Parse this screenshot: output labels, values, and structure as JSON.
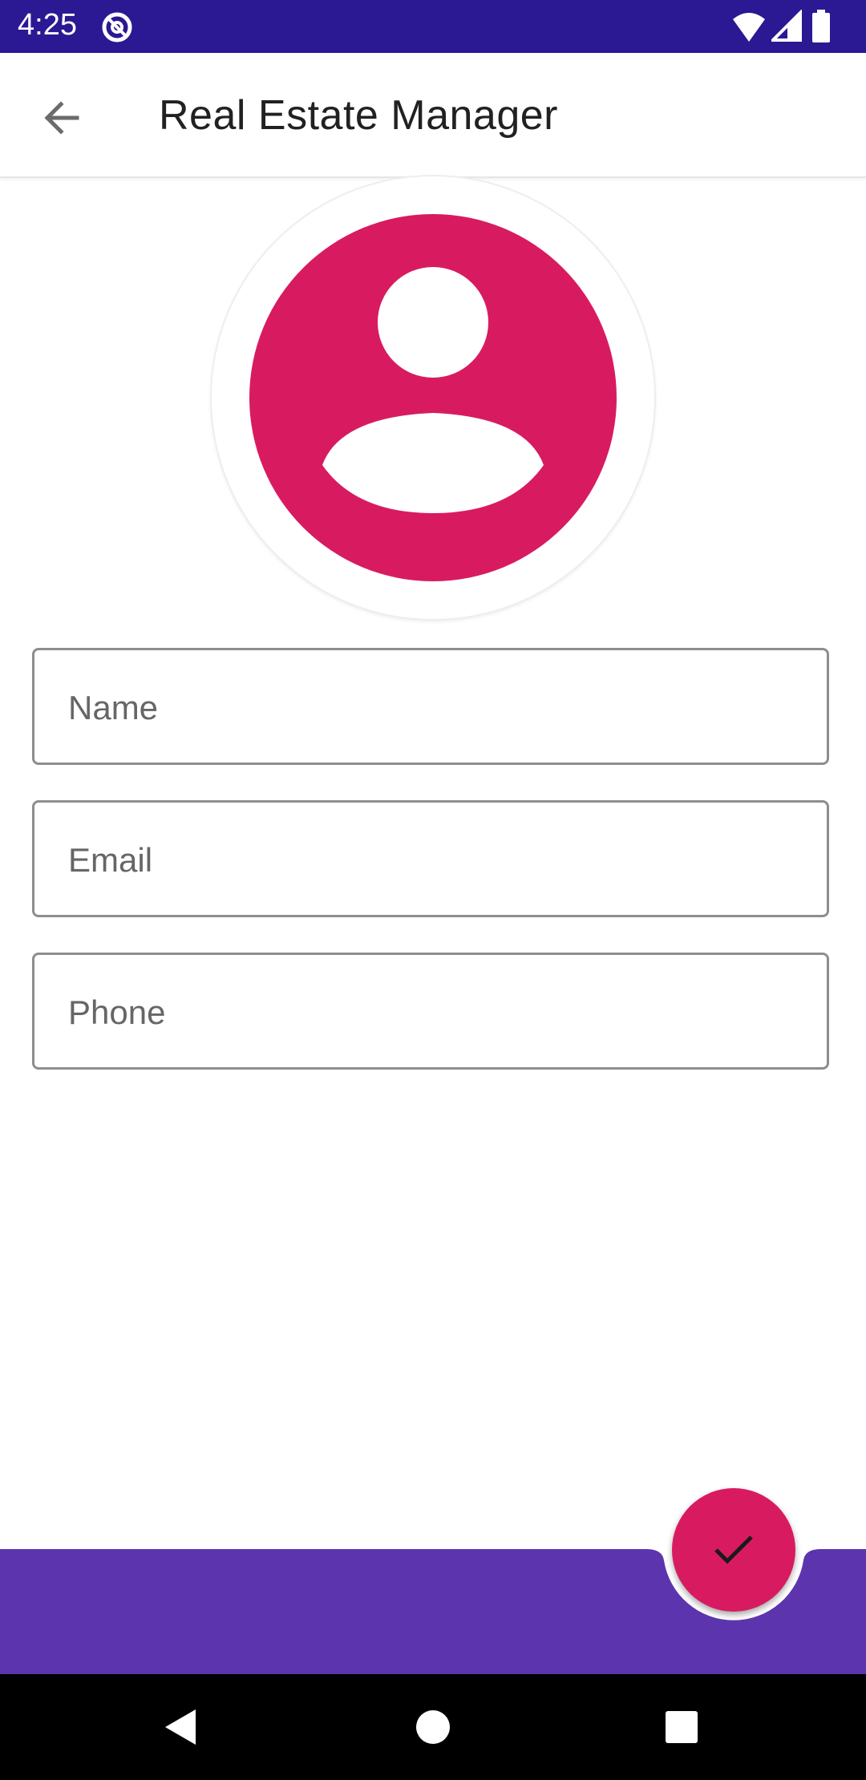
{
  "status_bar": {
    "time": "4:25",
    "icons": [
      "app-notification-icon",
      "wifi-icon",
      "cellular-signal-icon",
      "battery-icon"
    ]
  },
  "app_bar": {
    "back_icon": "arrow-back-icon",
    "title": "Real Estate Manager"
  },
  "avatar": {
    "icon": "account-circle-icon",
    "color": "#d81b60"
  },
  "form": {
    "name_placeholder": "Name",
    "email_placeholder": "Email",
    "phone_placeholder": "Phone"
  },
  "fab": {
    "icon": "check-icon",
    "color": "#d81b60"
  },
  "bottom_bar": {
    "color": "#5c35ae"
  },
  "nav_bar": {
    "icons": [
      "nav-back-icon",
      "nav-home-icon",
      "nav-recents-icon"
    ]
  }
}
